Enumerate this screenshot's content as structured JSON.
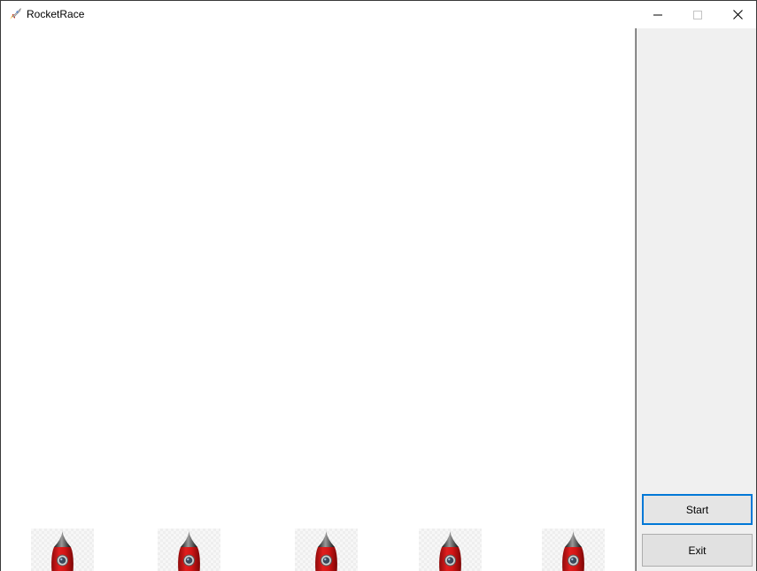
{
  "window": {
    "title": "RocketRace",
    "icon": "rocket-icon",
    "controls": [
      "minimize-icon",
      "maximize-icon",
      "close-icon"
    ]
  },
  "game": {
    "rockets": [
      {
        "name": "rocket-1",
        "progress": 0
      },
      {
        "name": "rocket-2",
        "progress": 0
      },
      {
        "name": "rocket-3",
        "progress": 0
      },
      {
        "name": "rocket-4",
        "progress": 0
      },
      {
        "name": "rocket-5",
        "progress": 0
      }
    ],
    "colors": {
      "rocket_body": "#d41616",
      "rocket_nose": "#2b2b2b",
      "accent_focus": "#0078d7",
      "panel_bg": "#f0f0f0"
    }
  },
  "controls": {
    "start_label": "Start",
    "exit_label": "Exit"
  }
}
